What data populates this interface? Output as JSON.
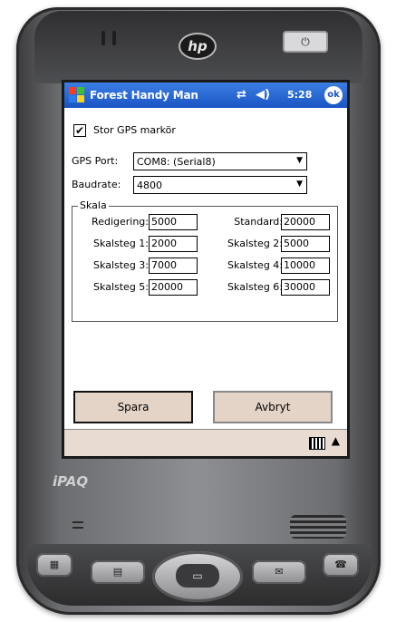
{
  "device": {
    "brand_logo": "hp",
    "model_label": "iPAQ",
    "power_icon": "power-icon"
  },
  "titlebar": {
    "app_title": "Forest Handy Man",
    "connectivity_icon": "connectivity-icon",
    "volume_icon": "speaker-icon",
    "time": "5:28",
    "ok_label": "ok"
  },
  "form": {
    "stor_gps": {
      "label": "Stor GPS markör",
      "checked": true
    },
    "gps_port": {
      "label": "GPS Port:",
      "value": "COM8: (Serial8)"
    },
    "baudrate": {
      "label": "Baudrate:",
      "value": "4800"
    },
    "skala": {
      "title": "Skala",
      "redigering": {
        "label": "Redigering:",
        "value": "5000"
      },
      "standard": {
        "label": "Standard:",
        "value": "20000"
      },
      "skalsteg1": {
        "label": "Skalsteg 1:",
        "value": "2000"
      },
      "skalsteg2": {
        "label": "Skalsteg 2:",
        "value": "5000"
      },
      "skalsteg3": {
        "label": "Skalsteg 3:",
        "value": "7000"
      },
      "skalsteg4": {
        "label": "Skalsteg 4:",
        "value": "10000"
      },
      "skalsteg5": {
        "label": "Skalsteg 5:",
        "value": "20000"
      },
      "skalsteg6": {
        "label": "Skalsteg 6:",
        "value": "30000"
      }
    },
    "spara_label": "Spara",
    "avbryt_label": "Avbryt"
  },
  "menubar": {
    "keyboard_icon": "keyboard-icon",
    "up_arrow": "▲"
  },
  "hardware_keys": {
    "calendar": "▦",
    "contacts": "▤",
    "mail": "✉",
    "phone": "☎"
  }
}
